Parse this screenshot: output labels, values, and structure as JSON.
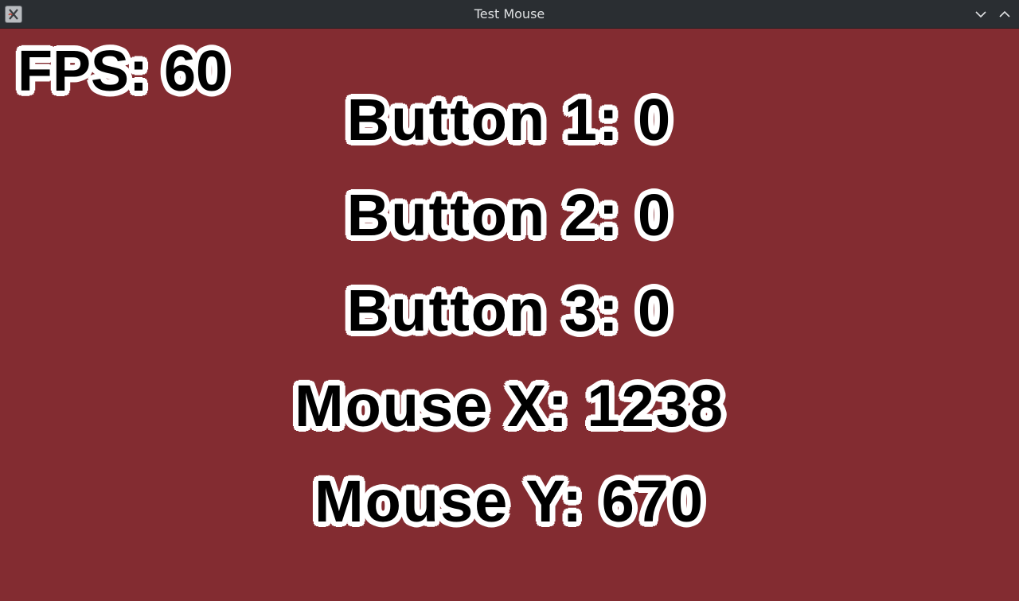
{
  "window": {
    "title": "Test Mouse",
    "app_icon": "x-window-icon",
    "controls": [
      "minimize-chevron-down-icon",
      "maximize-chevron-up-icon"
    ]
  },
  "canvas": {
    "background_color": "#832c31",
    "fps_label": "FPS: 60",
    "stats": [
      "Button 1: 0",
      "Button 2: 0",
      "Button 3: 0",
      "Mouse X: 1238",
      "Mouse Y: 670"
    ]
  }
}
